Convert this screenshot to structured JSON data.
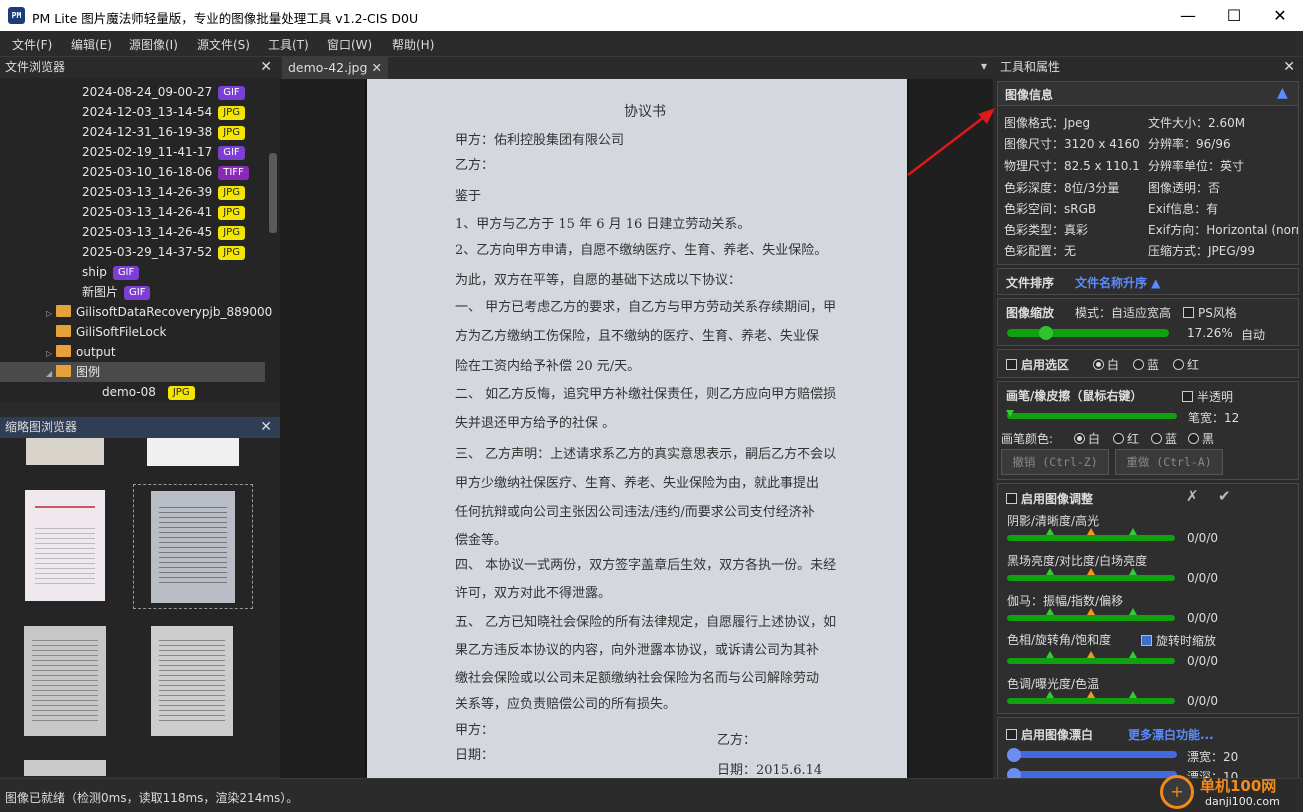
{
  "window": {
    "app_icon_text": "PM",
    "title": "PM Lite 图片魔法师轻量版，专业的图像批量处理工具 v1.2-CIS D0U",
    "minimize": "—",
    "maximize": "☐",
    "close": "✕"
  },
  "menu": [
    "文件(F)",
    "编辑(E)",
    "源图像(I)",
    "源文件(S)",
    "工具(T)",
    "窗口(W)",
    "帮助(H)"
  ],
  "file_browser": {
    "title": "文件浏览器",
    "close": "✕",
    "files": [
      {
        "name": "2024-08-24_09-00-27",
        "type": "GIF"
      },
      {
        "name": "2024-12-03_13-14-54",
        "type": "JPG"
      },
      {
        "name": "2024-12-31_16-19-38",
        "type": "JPG"
      },
      {
        "name": "2025-02-19_11-41-17",
        "type": "GIF"
      },
      {
        "name": "2025-03-10_16-18-06",
        "type": "TIFF"
      },
      {
        "name": "2025-03-13_14-26-39",
        "type": "JPG"
      },
      {
        "name": "2025-03-13_14-26-41",
        "type": "JPG"
      },
      {
        "name": "2025-03-13_14-26-45",
        "type": "JPG"
      },
      {
        "name": "2025-03-29_14-37-52",
        "type": "JPG"
      },
      {
        "name": "ship",
        "type": "GIF"
      },
      {
        "name": "新图片",
        "type": "GIF"
      }
    ],
    "folders": [
      {
        "name": "GilisoftDataRecoverypjb_889000",
        "expander": "▷"
      },
      {
        "name": "GiliSoftFileLock",
        "expander": ""
      },
      {
        "name": "output",
        "expander": "▷"
      },
      {
        "name": "图例",
        "expander": "◢"
      }
    ],
    "child": {
      "name": "demo-08",
      "type": "JPG"
    }
  },
  "thumb_browser": {
    "title": "缩略图浏览器",
    "close": "✕"
  },
  "document_tab": {
    "label": "demo-42.jpg",
    "close": "✕",
    "dropdown": "▾"
  },
  "paper": {
    "title": "协议书",
    "lines": [
      "甲方：佑利控股集团有限公司",
      "乙方：",
      "鉴于",
      "1、甲方与乙方于  15  年  6  月  16  日建立劳动关系。",
      "2、乙方向甲方申请，自愿不缴纳医疗、生育、养老、失业保险。",
      "为此，双方在平等，自愿的基础下达成以下协议：",
      "一、    甲方已考虑乙方的要求，自乙方与甲方劳动关系存续期间，甲",
      "        方为乙方缴纳工伤保险，且不缴纳的医疗、生育、养老、失业保",
      "        险在工资内给予补偿 20 元/天。",
      "二、    如乙方反悔，追究甲方补缴社保责任，则乙方应向甲方赔偿损",
      "        失并退还甲方给予的社保 。",
      "三、    乙方声明：上述请求系乙方的真实意思表示，嗣后乙方不会以",
      "        甲方少缴纳社保医疗、生育、养老、失业保险为由，就此事提出",
      "        任何抗辩或向公司主张因公司违法/违约/而要求公司支付经济补",
      "        偿金等。",
      "四、    本协议一式两份，双方签字盖章后生效，双方各执一份。未经",
      "        许可，双方对此不得泄露。",
      "五、    乙方已知晓社会保险的所有法律规定，自愿履行上述协议，如",
      "        果乙方违反本协议的内容，向外泄露本协议，或诉请公司为其补",
      "        缴社会保险或以公司未足额缴纳社会保险为名而与公司解除劳动",
      "        关系等，应负责赔偿公司的所有损失。",
      "        甲方：",
      "        日期："
    ],
    "sign_b": "乙方：",
    "date_b": "日期：2015.6.14"
  },
  "tools": {
    "title": "工具和属性",
    "close": "✕",
    "image_info": {
      "title": "图像信息",
      "collapse_icon": "▲",
      "left": [
        "图像格式：Jpeg",
        "图像尺寸：3120 x 4160",
        "物理尺寸：82.5 x 110.1",
        "色彩深度：8位/3分量",
        "色彩空间：sRGB",
        "色彩类型：真彩",
        "色彩配置：无"
      ],
      "right": [
        "文件大小：2.60M",
        "分辨率：96/96",
        "分辨率单位：英寸",
        "图像透明：否",
        "Exif信息：有",
        "Exif方向：Horizontal (norm",
        "压缩方式：JPEG/99"
      ]
    },
    "sort": {
      "label": "文件排序",
      "value": "文件名称升序 ▲"
    },
    "zoom": {
      "label": "图像缩放",
      "mode": "模式：自适应宽高",
      "ps_style": "PS风格",
      "percent": "17.26%",
      "auto": "自动",
      "level": 0.24
    },
    "selection": {
      "label": "启用选区",
      "white": "白",
      "blue": "蓝",
      "red": "红"
    },
    "brush": {
      "label": "画笔/橡皮擦（鼠标右键）",
      "semi": "半透明",
      "width_label": "笔宽：12",
      "color_label": "画笔颜色:",
      "colors": [
        "白",
        "红",
        "蓝",
        "黑"
      ],
      "undo": "撤销 (Ctrl-Z)",
      "redo": "重做 (Ctrl-A)"
    },
    "adjust": {
      "label": "启用图像调整",
      "cancel_icon": "✗",
      "ok_icon": "✔",
      "rows": [
        {
          "label": "阴影/清晰度/高光",
          "value": "0/0/0"
        },
        {
          "label": "黑场亮度/对比度/白场亮度",
          "value": "0/0/0"
        },
        {
          "label": "伽马：振幅/指数/偏移",
          "value": "0/0/0"
        },
        {
          "label": "色相/旋转角/饱和度",
          "value": "0/0/0",
          "extra": "旋转时缩放"
        },
        {
          "label": "色调/曝光度/色温",
          "value": "0/0/0"
        }
      ]
    },
    "bleach": {
      "label": "启用图像漂白",
      "more": "更多漂白功能...",
      "width": "漂宽：20",
      "depth": "漂深：10"
    }
  },
  "status": "图像已就绪（检测0ms，读取118ms，渲染214ms）。",
  "watermark": {
    "site": "单机100网",
    "url": "danji100.com"
  }
}
